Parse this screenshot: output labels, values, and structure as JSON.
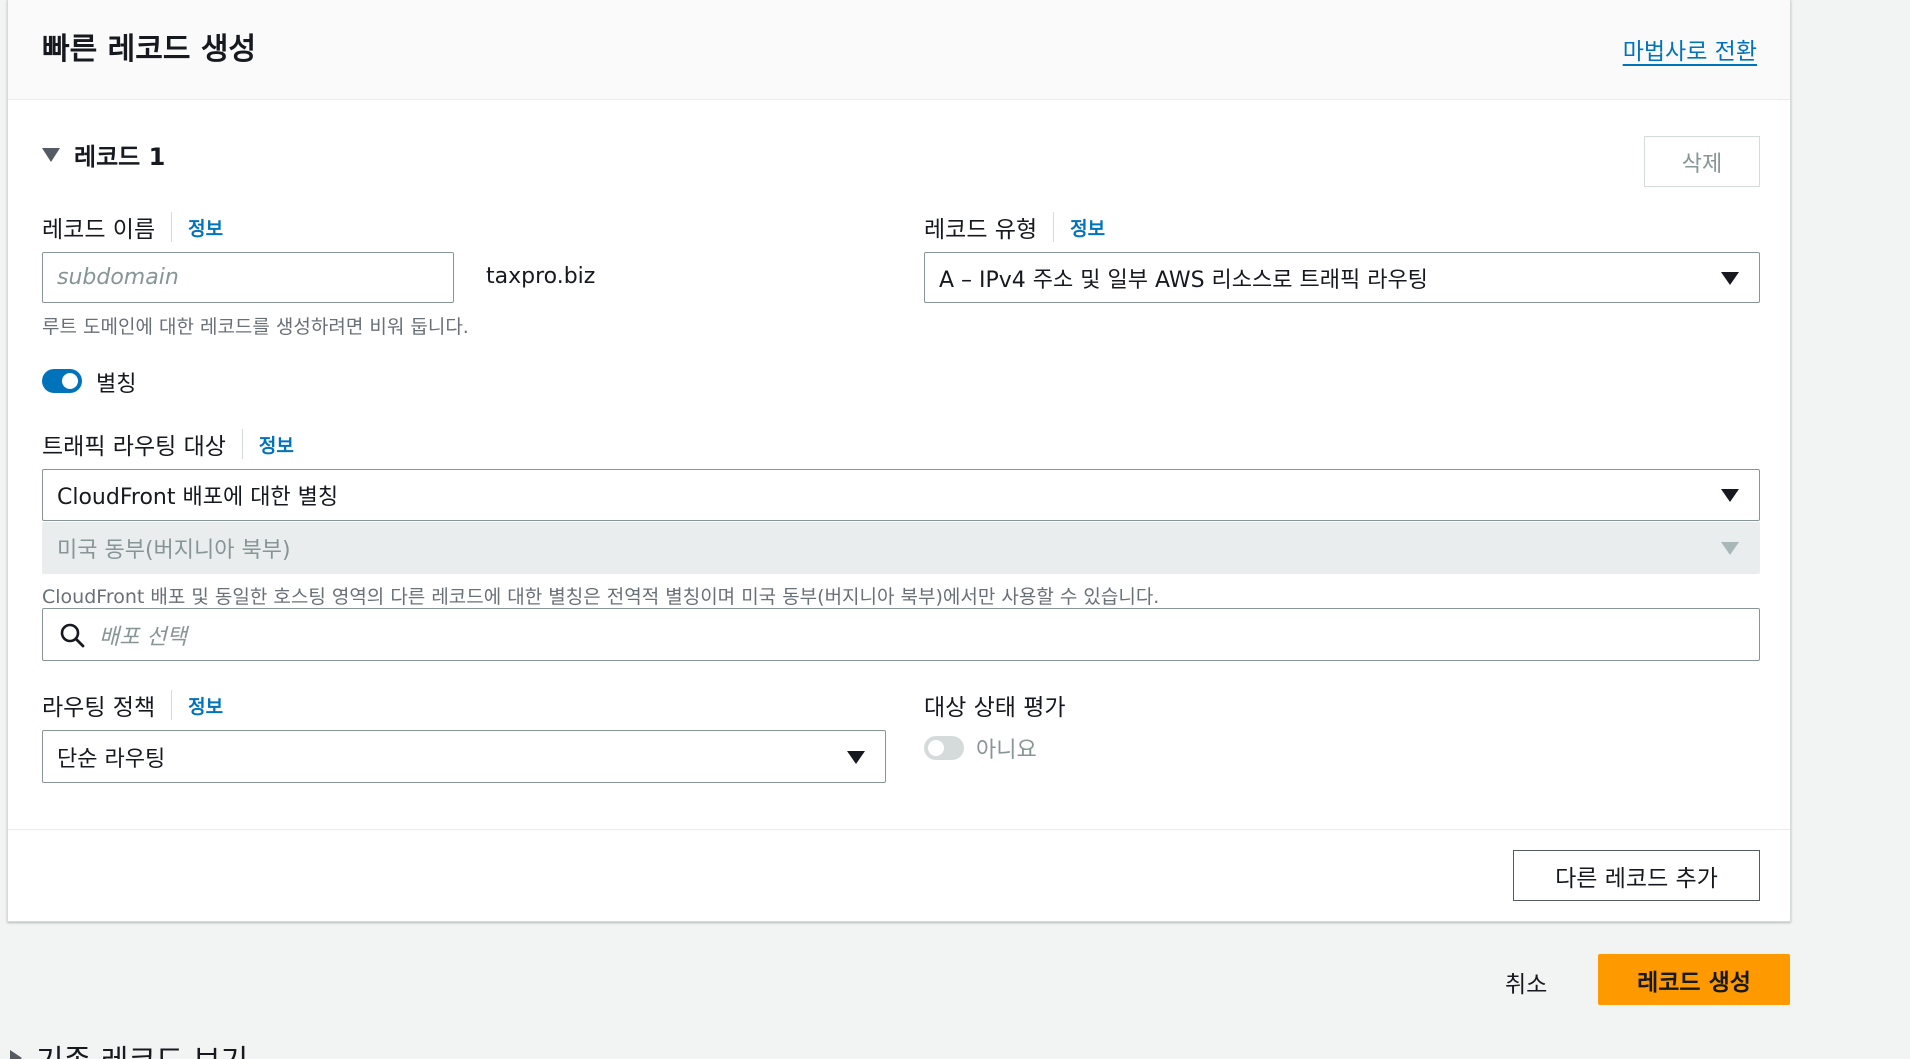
{
  "header": {
    "title": "빠른 레코드 생성",
    "wizard_link": "마법사로 전환"
  },
  "record": {
    "section_title": "레코드 1",
    "delete_label": "삭제",
    "name": {
      "label": "레코드 이름",
      "info": "정보",
      "placeholder": "subdomain",
      "domain_suffix": "taxpro.biz",
      "hint": "루트 도메인에 대한 레코드를 생성하려면 비워 둡니다."
    },
    "type": {
      "label": "레코드 유형",
      "info": "정보",
      "value": "A – IPv4 주소 및 일부 AWS 리소스로 트래픽 라우팅"
    },
    "alias": {
      "label": "별칭",
      "enabled": true
    },
    "target": {
      "label": "트래픽 라우팅 대상",
      "info": "정보",
      "endpoint_value": "CloudFront 배포에 대한 별칭",
      "region_value": "미국 동부(버지니아 북부)",
      "hint": "CloudFront 배포 및 동일한 호스팅 영역의 다른 레코드에 대한 별칭은 전역적 별칭이며 미국 동부(버지니아 북부)에서만 사용할 수 있습니다.",
      "search_placeholder": "배포 선택"
    },
    "routing_policy": {
      "label": "라우팅 정책",
      "info": "정보",
      "value": "단순 라우팅"
    },
    "health": {
      "label": "대상 상태 평가",
      "value": "아니요",
      "enabled": false
    },
    "add_record_label": "다른 레코드 추가"
  },
  "footer": {
    "cancel_label": "취소",
    "create_label": "레코드 생성"
  },
  "existing_records_label": "기존 레코드 보기",
  "colors": {
    "primary": "#ff9900",
    "link": "#0073bb",
    "toggle_on": "#0073bb"
  }
}
